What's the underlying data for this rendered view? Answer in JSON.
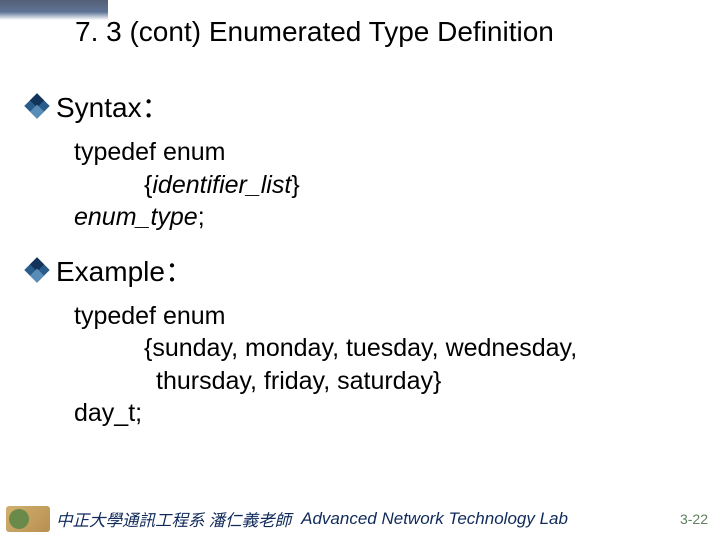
{
  "title": "7. 3 (cont) Enumerated Type Definition",
  "sections": {
    "syntax": {
      "label": "Syntax：",
      "line1": "typedef enum",
      "line2_open": "{",
      "line2_ident": "identifier_list",
      "line2_close": "}",
      "line3_type": "enum_type",
      "line3_semi": ";"
    },
    "example": {
      "label": "Example：",
      "line1": "typedef enum",
      "line2": "{sunday, monday, tuesday, wednesday,",
      "line3": "thursday, friday, saturday}",
      "line4": "day_t;"
    }
  },
  "footer": {
    "left": "中正大學通訊工程系 潘仁義老師",
    "right": "Advanced Network Technology Lab",
    "page": "3-22"
  }
}
